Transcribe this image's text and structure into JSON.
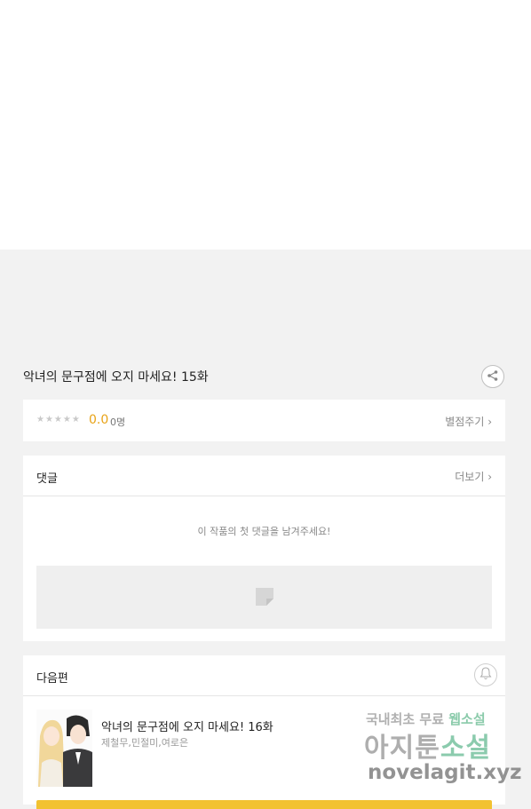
{
  "episode": {
    "title": "악녀의 문구점에 오지 마세요! 15화"
  },
  "rating": {
    "stars": "★★★★★",
    "score": "0.0",
    "count": "0명",
    "rate_link": "별점주기 ›"
  },
  "comments": {
    "header": "댓글",
    "more_link": "더보기 ›",
    "empty_message": "이 작품의 첫 댓글을 남겨주세요!"
  },
  "next_episode": {
    "header": "다음편",
    "title": "악녀의 문구점에 오지 마세요! 16화",
    "authors": "제철무,민절미,여로은"
  },
  "watermark": {
    "line1_a": "국내최초 무료 ",
    "line1_b": "웹소설",
    "line2_a": "아지툰",
    "line2_b": "소설",
    "line3": "novelagit.xyz"
  },
  "colors": {
    "accent_yellow": "#f2c230",
    "score_orange": "#e8a317",
    "background": "#f2f2f2"
  }
}
